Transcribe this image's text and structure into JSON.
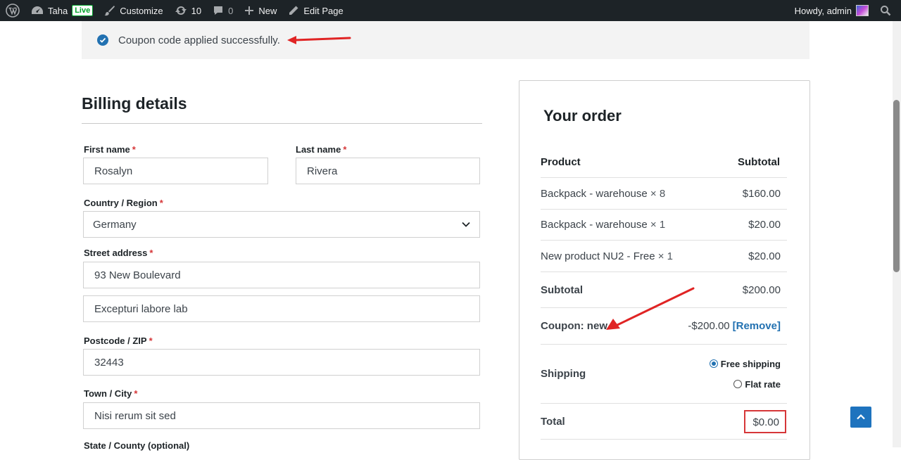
{
  "admin_bar": {
    "site_name": "Taha",
    "live_badge": "Live",
    "customize": "Customize",
    "updates_count": "10",
    "comments_count": "0",
    "new": "New",
    "edit_page": "Edit Page",
    "howdy": "Howdy, admin"
  },
  "notice": {
    "message": "Coupon code applied successfully."
  },
  "billing": {
    "title": "Billing details",
    "required_marker": "*",
    "first_name": {
      "label": "First name",
      "value": "Rosalyn"
    },
    "last_name": {
      "label": "Last name",
      "value": "Rivera"
    },
    "country": {
      "label": "Country / Region",
      "value": "Germany"
    },
    "street": {
      "label": "Street address",
      "value1": "93 New Boulevard",
      "value2": "Excepturi labore lab"
    },
    "postcode": {
      "label": "Postcode / ZIP",
      "value": "32443"
    },
    "city": {
      "label": "Town / City",
      "value": "Nisi rerum sit sed"
    },
    "state": {
      "label": "State / County (optional)"
    }
  },
  "order": {
    "title": "Your order",
    "col_product": "Product",
    "col_subtotal": "Subtotal",
    "items": [
      {
        "name": "Backpack - warehouse",
        "qty": "× 8",
        "price": "$160.00"
      },
      {
        "name": "Backpack - warehouse",
        "qty": "× 1",
        "price": "$20.00"
      },
      {
        "name": "New product NU2 - Free",
        "qty": "× 1",
        "price": "$20.00"
      }
    ],
    "subtotal_label": "Subtotal",
    "subtotal_value": "$200.00",
    "coupon_label": "Coupon: new",
    "coupon_value": "-$200.00",
    "coupon_remove": "[Remove]",
    "shipping_label": "Shipping",
    "shipping_options": [
      {
        "label": "Free shipping",
        "selected": true
      },
      {
        "label": "Flat rate",
        "selected": false
      }
    ],
    "total_label": "Total",
    "total_value": "$0.00"
  },
  "colors": {
    "admin_bar": "#1d2327",
    "accent": "#2271b1",
    "required": "#d63638",
    "annotation": "#e02424"
  },
  "icons": [
    "wordpress-icon",
    "dashboard-icon",
    "brush-icon",
    "updates-icon",
    "comment-icon",
    "plus-icon",
    "pencil-icon",
    "search-icon",
    "check-circle-icon",
    "chevron-down-icon",
    "arrow-up-icon"
  ]
}
